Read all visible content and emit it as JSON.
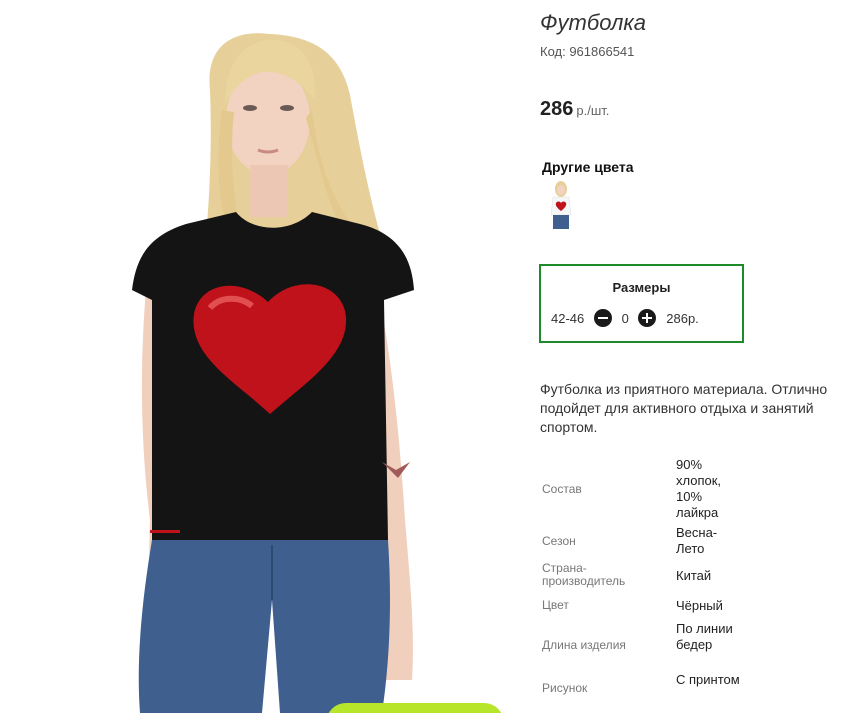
{
  "product": {
    "title": "Футболка",
    "code": "Код: 961866541",
    "price_value": "286",
    "price_unit": "р./шт.",
    "image_icon": "product-photo"
  },
  "other_colors": {
    "title": "Другие цвета",
    "thumb_icon": "color-variant-thumbnail"
  },
  "sizes": {
    "title": "Размеры",
    "rows": [
      {
        "label": "42-46",
        "quantity": "0",
        "price": "286р."
      }
    ]
  },
  "description": "Футболка из приятного материала. Отлично подойдет для активного отдыха и занятий спортом.",
  "specs": [
    {
      "key": "Состав",
      "value": "90% хлопок, 10% лайкра"
    },
    {
      "key": "Сезон",
      "value": "Весна-Лето"
    },
    {
      "key": "Страна-производитель",
      "value": "Китай"
    },
    {
      "key": "Цвет",
      "value": "Чёрный"
    },
    {
      "key": "Длина изделия",
      "value": "По линии бедер"
    },
    {
      "key": "Рисунок",
      "value": "С принтом"
    }
  ],
  "colors": {
    "sizes_border": "#1f8a2a",
    "cart_button": "#b7e52a",
    "shirt": "#141414",
    "heart": "#c0121a"
  }
}
